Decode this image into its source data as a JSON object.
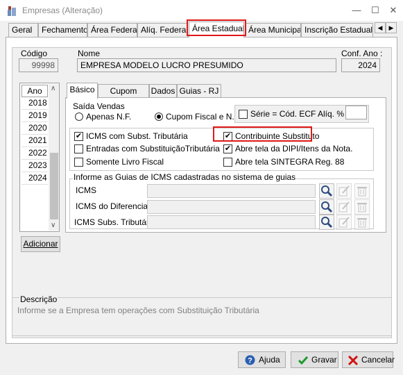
{
  "window": {
    "title": "Empresas (Alteração)",
    "minimize": "—",
    "maximize": "☐",
    "close": "✕"
  },
  "tabs": [
    "Geral",
    "Fechamento",
    "Área Federal",
    "Alíq. Federais",
    "Área Estadual",
    "Área Municipal",
    "Inscrição Estadual S"
  ],
  "active_tab": "Área Estadual",
  "header": {
    "codigo_label": "Código",
    "codigo_value": "99998",
    "nome_label": "Nome",
    "nome_value": "EMPRESA MODELO LUCRO PRESUMIDO",
    "conf_ano_label": "Conf. Ano :",
    "conf_ano_value": "2024"
  },
  "ano_list": {
    "header": "Ano",
    "years": [
      "2018",
      "2019",
      "2020",
      "2021",
      "2022",
      "2023",
      "2024"
    ],
    "adicionar": "Adicionar"
  },
  "subtabs": [
    "Básico",
    "Cupom Fiscal",
    "Dados",
    "Guias - RJ"
  ],
  "active_subtab": "Básico",
  "saida_vendas": {
    "legend": "Saída Vendas",
    "options": [
      {
        "label": "Apenas N.F.",
        "selected": false
      },
      {
        "label": "Cupom Fiscal e N.F.",
        "selected": true
      }
    ],
    "serie_label": "Série = Cód. ECF",
    "serie_checked": false,
    "aliq_label": "Alíq. %",
    "aliq_value": ""
  },
  "checkboxes_left": [
    {
      "label": "ICMS com Subst. Tributária",
      "checked": true
    },
    {
      "label": "Entradas com SubstituiçãoTributária",
      "checked": false
    },
    {
      "label": "Somente Livro Fiscal",
      "checked": false
    }
  ],
  "checkboxes_right": [
    {
      "label": "Contribuinte Substituto",
      "checked": true
    },
    {
      "label": "Abre tela da DIPI/Itens da Nota.",
      "checked": true
    },
    {
      "label": "Abre tela SINTEGRA Reg. 88",
      "checked": false
    }
  ],
  "guias": {
    "legend": "Informe as Guias de ICMS cadastradas no sistema de guias",
    "rows": [
      {
        "label": "ICMS",
        "value": ""
      },
      {
        "label": "ICMS do Diferencial",
        "value": ""
      },
      {
        "label": "ICMS Subs. Tributária",
        "value": ""
      }
    ]
  },
  "descricao": {
    "label": "Descrição",
    "text": "Informe se a Empresa tem operações com Substituição Tributária"
  },
  "buttons": {
    "ajuda": "Ajuda",
    "gravar": "Gravar",
    "cancelar": "Cancelar"
  },
  "colors": {
    "highlight": "#e01818",
    "help_icon": "#2a5fb0",
    "ok_icon": "#1e9a2c",
    "cancel_icon": "#d01414"
  }
}
